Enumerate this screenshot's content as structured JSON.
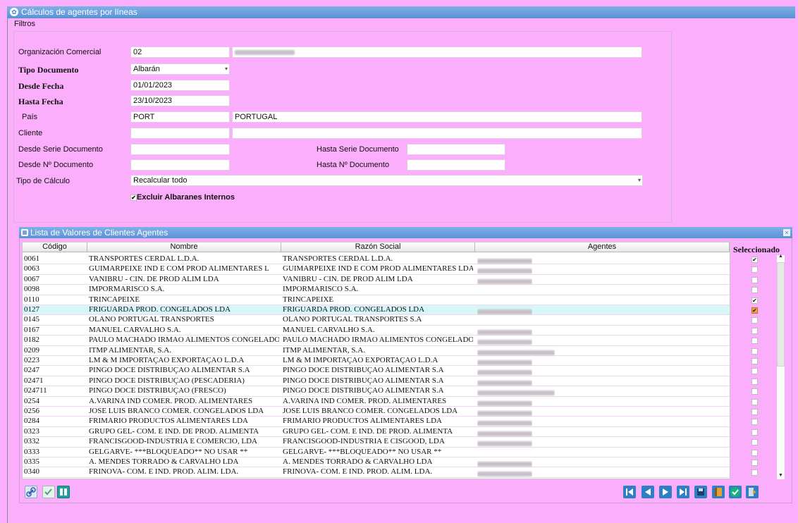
{
  "window": {
    "title": "Cálculos de agentes por líneas"
  },
  "menu": {
    "filters": "Filtros"
  },
  "filters": {
    "org_label": "Organización Comercial",
    "org_code": "02",
    "tipo_doc_label": "Tipo Documento",
    "tipo_doc_value": "Albarán",
    "desde_fecha_label": "Desde Fecha",
    "desde_fecha_value": "01/01/2023",
    "hasta_fecha_label": "Hasta Fecha",
    "hasta_fecha_value": "23/10/2023",
    "pais_label": "País",
    "pais_code": "PORT",
    "pais_name": "PORTUGAL",
    "cliente_label": "Cliente",
    "desde_serie_label": "Desde Serie Documento",
    "hasta_serie_label": "Hasta Serie Documento",
    "desde_num_label": "Desde Nº Documento",
    "hasta_num_label": "Hasta Nº Documento",
    "tipo_calculo_label": "Tipo de Cálculo",
    "tipo_calculo_value": "Recalcular todo",
    "excluir_label": "Excluir Albaranes Internos",
    "excluir_checked": true
  },
  "list": {
    "title": "Lista de Valores de Clientes Agentes",
    "columns": {
      "codigo": "Código",
      "nombre": "Nombre",
      "razon": "Razón Social",
      "agentes": "Agentes",
      "seleccionado": "Seleccionado"
    },
    "rows": [
      {
        "codigo": "0061",
        "nombre": "TRANSPORTES CERDAL L.D.A.",
        "razon": "TRANSPORTES CERDAL L.D.A.",
        "checked": true
      },
      {
        "codigo": "0063",
        "nombre": "GUIMARPEIXE IND E COM PROD ALIMENTARES L",
        "razon": "GUIMARPEIXE IND E COM PROD ALIMENTARES LDA",
        "checked": false
      },
      {
        "codigo": "0067",
        "nombre": "VANIBRU - CIN. DE PROD ALIM LDA",
        "razon": "VANIBRU - CIN. DE PROD ALIM LDA",
        "checked": false
      },
      {
        "codigo": "0098",
        "nombre": "IMPORMARISCO S.A.",
        "razon": "IMPORMARISCO S.A.",
        "checked": false
      },
      {
        "codigo": "0110",
        "nombre": "TRINCAPEIXE",
        "razon": "TRINCAPEIXE",
        "checked": true
      },
      {
        "codigo": "0127",
        "nombre": "FRIGUARDA PROD. CONGELADOS LDA",
        "razon": "FRIGUARDA PROD. CONGELADOS LDA",
        "checked": true
      },
      {
        "codigo": "0145",
        "nombre": "OLANO PORTUGAL TRANSPORTES",
        "razon": "OLANO PORTUGAL TRANSPORTES S.A",
        "checked": false
      },
      {
        "codigo": "0167",
        "nombre": "MANUEL CARVALHO S.A.",
        "razon": "MANUEL CARVALHO S.A.",
        "checked": false
      },
      {
        "codigo": "0182",
        "nombre": "PAULO MACHADO IRMAO ALIMENTOS CONGELADOS",
        "razon": "PAULO MACHADO IRMAO ALIMENTOS CONGELADOS",
        "checked": false
      },
      {
        "codigo": "0209",
        "nombre": "ITMP ALIMENTAR, S.A.",
        "razon": "ITMP ALIMENTAR, S.A.",
        "checked": false
      },
      {
        "codigo": "0223",
        "nombre": "LM & M  IMPORTAÇAO EXPORTAÇAO L.D.A",
        "razon": "LM & M  IMPORTAÇAO EXPORTAÇAO L.D.A",
        "checked": false
      },
      {
        "codigo": "0247",
        "nombre": "PINGO DOCE DISTRIBUÇAO ALIMENTAR S.A",
        "razon": "PINGO DOCE DISTRIBUÇAO ALIMENTAR S.A",
        "checked": false
      },
      {
        "codigo": "02471",
        "nombre": "PINGO DOCE DISTRIBUÇAO (PESCADERIA)",
        "razon": "PINGO DOCE DISTRIBUÇAO ALIMENTAR S.A",
        "checked": false
      },
      {
        "codigo": "024711",
        "nombre": "PINGO DOCE DISTRIBUÇAO (FRESCO)",
        "razon": "PINGO DOCE DISTRIBUÇAO ALIMENTAR S.A",
        "checked": false
      },
      {
        "codigo": "0254",
        "nombre": "A.VARINA IND  COMER. PROD. ALIMENTARES",
        "razon": "A.VARINA IND  COMER. PROD. ALIMENTARES",
        "checked": false
      },
      {
        "codigo": "0256",
        "nombre": "JOSE LUIS BRANCO COMER. CONGELADOS LDA",
        "razon": "JOSE LUIS BRANCO COMER. CONGELADOS LDA",
        "checked": false
      },
      {
        "codigo": "0284",
        "nombre": "FRIMARIO PRODUCTOS ALIMENTARES LDA",
        "razon": "FRIMARIO PRODUCTOS ALIMENTARES LDA",
        "checked": false
      },
      {
        "codigo": "0323",
        "nombre": "GRUPO GEL- COM. E IND. DE PROD. ALIMENTA",
        "razon": "GRUPO GEL- COM. E IND. DE PROD. ALIMENTA",
        "checked": false
      },
      {
        "codigo": "0332",
        "nombre": "FRANCISGOOD-INDUSTRIA E COMERCIO, LDA",
        "razon": "FRANCISGOOD-INDUSTRIA E CISGOOD, LDA",
        "checked": false
      },
      {
        "codigo": "0333",
        "nombre": "GELGARVE- ***BLOQUEADO** NO USAR **",
        "razon": "GELGARVE- ***BLOQUEADO** NO USAR **",
        "checked": false
      },
      {
        "codigo": "0335",
        "nombre": "A. MENDES TORRADO & CARVALHO LDA",
        "razon": "A. MENDES TORRADO & CARVALHO LDA",
        "checked": false
      },
      {
        "codigo": "0340",
        "nombre": "FRINOVA- COM. E IND. PROD. ALIM. LDA.",
        "razon": "FRINOVA- COM. E IND. PROD. ALIM. LDA.",
        "checked": false
      }
    ],
    "agent_blur": [
      1,
      1,
      1,
      0,
      0,
      1,
      0,
      1,
      1,
      2,
      1,
      1,
      1,
      2,
      1,
      1,
      1,
      1,
      1,
      0,
      1,
      1
    ],
    "selected_row": 5
  },
  "icons": {
    "left": [
      "link-icon",
      "check-list-icon",
      "grid-view-icon"
    ],
    "right": [
      "first-record-icon",
      "previous-record-icon",
      "next-record-icon",
      "last-record-icon",
      "save-icon",
      "book-icon",
      "accept-icon",
      "exit-icon"
    ]
  },
  "colors": {
    "background": "#fbaefb",
    "titlebar": "#5b92d6",
    "selected_row": "#d7f7f7",
    "accent": "#2f7fc4",
    "ok": "#17b37a"
  }
}
